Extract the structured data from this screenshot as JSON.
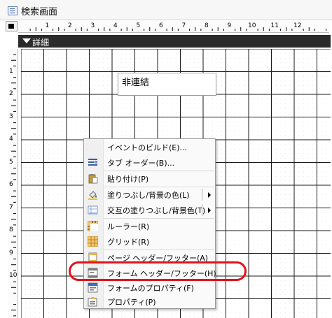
{
  "window": {
    "title": "検索画面",
    "icon": "form-icon"
  },
  "ruler": {
    "h_numbers": [
      "1",
      "2",
      "3",
      "4",
      "5",
      "6",
      "7",
      "8",
      "9",
      "10",
      "11",
      "12"
    ],
    "v_numbers": [
      "1",
      "2",
      "3",
      "4",
      "5",
      "6",
      "7",
      "8",
      "9",
      "10"
    ]
  },
  "section": {
    "label": "詳細",
    "icon": "section-arrow-icon"
  },
  "control": {
    "text": "非連結"
  },
  "menu": {
    "items": [
      {
        "label": "イベントのビルド(E)...",
        "icon": ""
      },
      {
        "label": "タブ オーダー(B)...",
        "icon": "tab-order-icon"
      },
      {
        "label": "貼り付け(P)",
        "icon": "paste-icon"
      },
      {
        "label": "塗りつぶし/背景の色(L)",
        "icon": "fill-color-icon",
        "submenu": true
      },
      {
        "label": "交互の塗りつぶし/背景色(T)",
        "icon": "alternate-fill-icon",
        "submenu": true
      },
      {
        "label": "ルーラー(R)",
        "icon": "ruler-icon"
      },
      {
        "label": "グリッド(R)",
        "icon": "grid-icon"
      },
      {
        "label": "ページ ヘッダー/フッター(A)",
        "icon": "page-header-icon"
      },
      {
        "label": "フォーム ヘッダー/フッター(H)",
        "icon": "form-header-icon"
      },
      {
        "label": "フォームのプロパティ(F)",
        "icon": "form-properties-icon"
      },
      {
        "label": "プロパティ(P)",
        "icon": "properties-icon"
      }
    ]
  },
  "colors": {
    "highlight": "#e0141b",
    "section_bar": "#2b2b2b"
  }
}
